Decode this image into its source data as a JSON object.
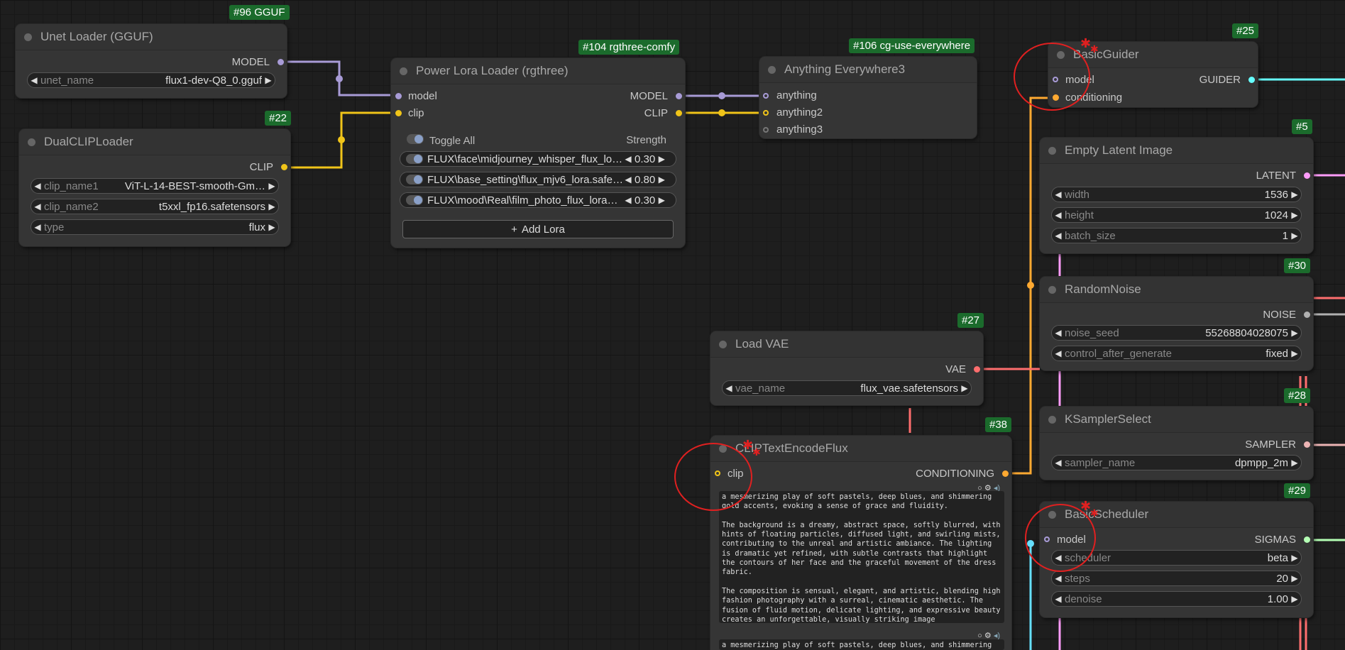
{
  "colors": {
    "model": "#a89bd6",
    "clip": "#f0c419",
    "vae": "#ff6e6e",
    "latent": "#ff9cf9",
    "conditioning": "#ffa931",
    "guider": "#66ffff",
    "sigmas": "#b4ffb4",
    "sampler": "#ecb4b4",
    "noise": "#b0b0b0",
    "badge": "#1b6b2c",
    "annotation": "#e02020"
  },
  "nodes": {
    "unet": {
      "badge": "#96 GGUF",
      "title": "Unet Loader (GGUF)",
      "out_model": "MODEL",
      "w_label": "unet_name",
      "w_value": "flux1-dev-Q8_0.gguf"
    },
    "dualclip": {
      "badge": "#22",
      "title": "DualCLIPLoader",
      "out_clip": "CLIP",
      "widgets": [
        {
          "label": "clip_name1",
          "value": "ViT-L-14-BEST-smooth-Gm…"
        },
        {
          "label": "clip_name2",
          "value": "t5xxl_fp16.safetensors"
        },
        {
          "label": "type",
          "value": "flux"
        }
      ]
    },
    "lora": {
      "badge": "#104 rgthree-comfy",
      "title": "Power Lora Loader (rgthree)",
      "in_model": "model",
      "in_clip": "clip",
      "out_model": "MODEL",
      "out_clip": "CLIP",
      "toggle_all": "Toggle All",
      "strength": "Strength",
      "loras": [
        {
          "name": "FLUX\\face\\midjourney_whisper_flux_lo…",
          "value": "0.30"
        },
        {
          "name": "FLUX\\base_setting\\flux_mjv6_lora.safe…",
          "value": "0.80"
        },
        {
          "name": "FLUX\\mood\\Real\\film_photo_flux_lora…",
          "value": "0.30"
        }
      ],
      "add_lora": "Add Lora"
    },
    "anything": {
      "badge": "#106 cg-use-everywhere",
      "title": "Anything Everywhere3",
      "inputs": [
        "anything",
        "anything2",
        "anything3"
      ]
    },
    "vae": {
      "badge": "#27",
      "title": "Load VAE",
      "out": "VAE",
      "w_label": "vae_name",
      "w_value": "flux_vae.safetensors"
    },
    "clipenc": {
      "badge": "#38",
      "title": "CLIPTextEncodeFlux",
      "in_clip": "clip",
      "out": "CONDITIONING",
      "text1": "a mesmerizing play of soft pastels, deep blues, and shimmering\ngold accents, evoking a sense of grace and fluidity.\n\nThe background is a dreamy, abstract space, softly blurred, with\nhints of floating particles, diffused light, and swirling mists,\ncontributing to the unreal and artistic ambiance. The lighting\nis dramatic yet refined, with subtle contrasts that highlight\nthe contours of her face and the graceful movement of the dress\nfabric.\n\nThe composition is sensual, elegant, and artistic, blending high\nfashion photography with a surreal, cinematic aesthetic. The\nfusion of fluid motion, delicate lighting, and expressive beauty\ncreates an unforgettable, visually striking image",
      "text2": "a mesmerizing play of soft pastels, deep blues, and shimmering"
    },
    "guider": {
      "badge": "#25",
      "title": "BasicGuider",
      "in_model": "model",
      "in_cond": "conditioning",
      "out": "GUIDER"
    },
    "latent": {
      "badge": "#5",
      "title": "Empty Latent Image",
      "out": "LATENT",
      "widgets": [
        {
          "label": "width",
          "value": "1536"
        },
        {
          "label": "height",
          "value": "1024"
        },
        {
          "label": "batch_size",
          "value": "1"
        }
      ]
    },
    "noise": {
      "badge": "#30",
      "title": "RandomNoise",
      "out": "NOISE",
      "widgets": [
        {
          "label": "noise_seed",
          "value": "55268804028075"
        },
        {
          "label": "control_after_generate",
          "value": "fixed"
        }
      ]
    },
    "ksel": {
      "badge": "#28",
      "title": "KSamplerSelect",
      "out": "SAMPLER",
      "widgets": [
        {
          "label": "sampler_name",
          "value": "dpmpp_2m"
        }
      ]
    },
    "sched": {
      "badge": "#29",
      "title": "BasicScheduler",
      "in_model": "model",
      "out": "SIGMAS",
      "widgets": [
        {
          "label": "scheduler",
          "value": "beta"
        },
        {
          "label": "steps",
          "value": "20"
        },
        {
          "label": "denoise",
          "value": "1.00"
        }
      ]
    }
  }
}
